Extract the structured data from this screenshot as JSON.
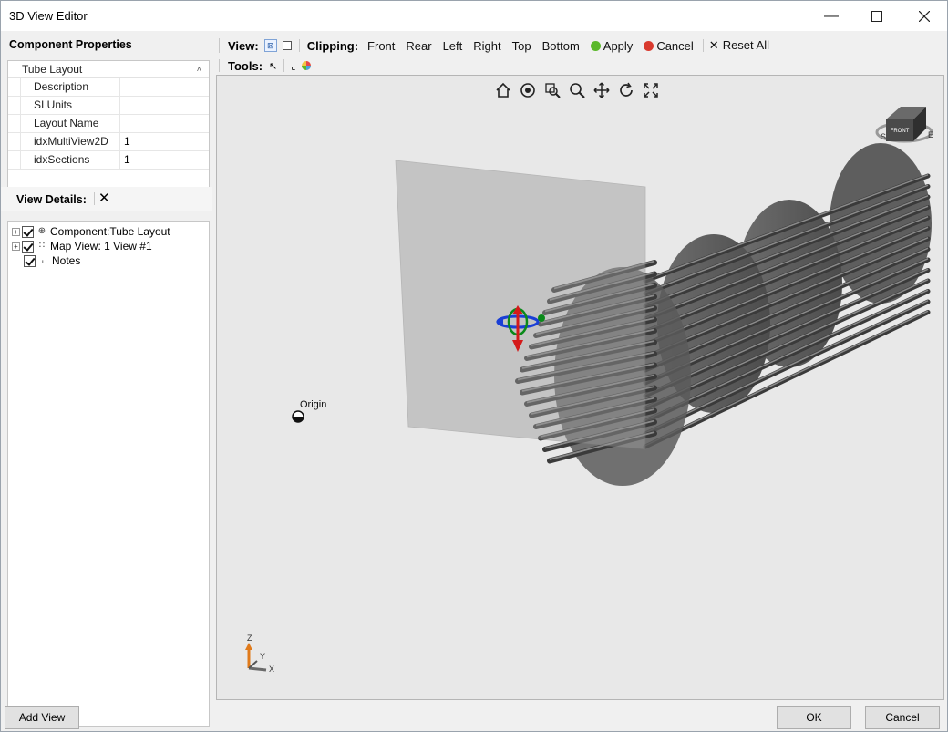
{
  "window": {
    "title": "3D View Editor"
  },
  "left": {
    "props_title": "Component Properties",
    "props_header": "Tube Layout",
    "props": [
      {
        "key": "Description",
        "value": ""
      },
      {
        "key": "SI Units",
        "value": ""
      },
      {
        "key": "Layout Name",
        "value": ""
      },
      {
        "key": "idxMultiView2D",
        "value": "1"
      },
      {
        "key": "idxSections",
        "value": "1"
      }
    ],
    "view_details_title": "View Details:",
    "tree": [
      {
        "label": "Component:Tube Layout",
        "expandable": true,
        "checked": true,
        "icon": "component-icon"
      },
      {
        "label": "Map View: 1 View #1",
        "expandable": true,
        "checked": true,
        "icon": "map-icon"
      },
      {
        "label": "Notes",
        "expandable": false,
        "checked": true,
        "icon": "notes-icon"
      }
    ]
  },
  "toolbar": {
    "view_label": "View:",
    "clipping_label": "Clipping:",
    "clip_items": [
      "Front",
      "Rear",
      "Left",
      "Right",
      "Top",
      "Bottom"
    ],
    "apply": "Apply",
    "cancel": "Cancel",
    "reset_all": "Reset All",
    "tools_label": "Tools:",
    "apply_color": "#5ab82a",
    "cancel_color": "#d93a2e"
  },
  "viewport": {
    "origin_label": "Origin",
    "cube_label": "FRONT",
    "axes": {
      "z": "Z",
      "y": "Y",
      "x": "X"
    },
    "background": "#e8e8e8"
  },
  "bottom": {
    "add_view": "Add View",
    "ok": "OK",
    "cancel": "Cancel"
  }
}
